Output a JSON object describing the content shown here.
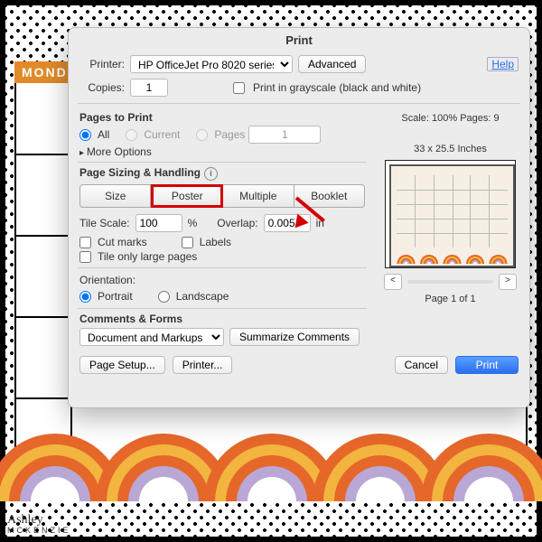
{
  "bg": {
    "day_label": "MOND",
    "watermark_name": "Ashley",
    "watermark_brand": "MCKENZIE"
  },
  "dialog": {
    "title": "Print",
    "printer_label": "Printer:",
    "printer_value": "HP OfficeJet Pro 8020 series",
    "advanced": "Advanced",
    "help": "Help",
    "copies_label": "Copies:",
    "copies_value": "1",
    "grayscale": "Print in grayscale (black and white)",
    "pages_to_print": "Pages to Print",
    "all": "All",
    "current": "Current",
    "pages": "Pages",
    "pages_val": "1",
    "more_options": "More Options",
    "sizing_title": "Page Sizing & Handling",
    "seg": {
      "size": "Size",
      "poster": "Poster",
      "multiple": "Multiple",
      "booklet": "Booklet"
    },
    "tile_scale_label": "Tile Scale:",
    "tile_scale": "100",
    "pct": "%",
    "overlap_label": "Overlap:",
    "overlap": "0.005",
    "overlap_unit": "in",
    "cut_marks": "Cut marks",
    "labels": "Labels",
    "tile_only": "Tile only large pages",
    "orientation": "Orientation:",
    "portrait": "Portrait",
    "landscape": "Landscape",
    "comments_title": "Comments & Forms",
    "comments_sel": "Document and Markups",
    "summarize": "Summarize Comments",
    "page_setup": "Page Setup...",
    "printer_btn": "Printer...",
    "cancel": "Cancel",
    "print": "Print"
  },
  "preview": {
    "scale_line": "Scale: 100% Pages: 9",
    "dims": "33 x 25.5 Inches",
    "page_of": "Page 1 of 1",
    "prev": "<",
    "next": ">"
  }
}
